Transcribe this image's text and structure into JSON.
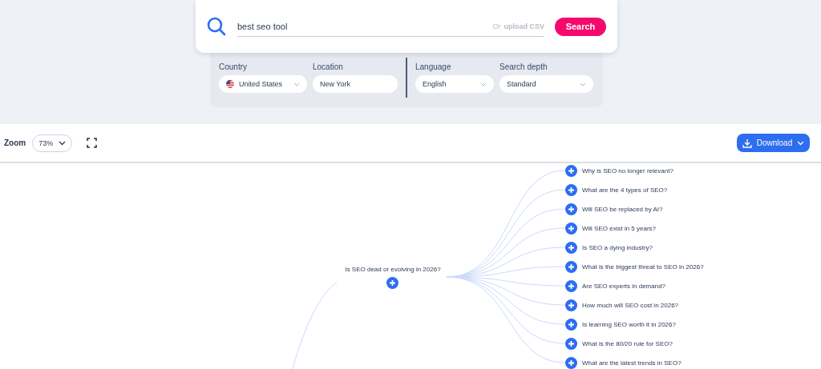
{
  "search": {
    "query": "best seo tool",
    "upload_prefix": "Or",
    "upload_link": "upload CSV",
    "button": "Search"
  },
  "filters": [
    {
      "label": "Country",
      "value": "United States",
      "kind": "flag-select"
    },
    {
      "label": "Location",
      "value": "New York",
      "kind": "text"
    },
    {
      "label": "Language",
      "value": "English",
      "kind": "select"
    },
    {
      "label": "Search depth",
      "value": "Standard",
      "kind": "select"
    }
  ],
  "toolbar": {
    "zoom_label": "Zoom",
    "zoom_value": "73%",
    "download": "Download"
  },
  "mindmap": {
    "root": "Is SEO dead or evolving in 2026?",
    "children": [
      "Why is SEO no longer relevant?",
      "What are the 4 types of SEO?",
      "Will SEO be replaced by AI?",
      "Will SEO exist in 5 years?",
      "Is SEO a dying industry?",
      "What is the biggest threat to SEO in 2026?",
      "Are SEO experts in demand?",
      "How much will SEO cost in 2026?",
      "Is learning SEO worth it in 2026?",
      "What is the 80/20 rule for SEO?",
      "What are the latest trends in SEO?"
    ]
  }
}
